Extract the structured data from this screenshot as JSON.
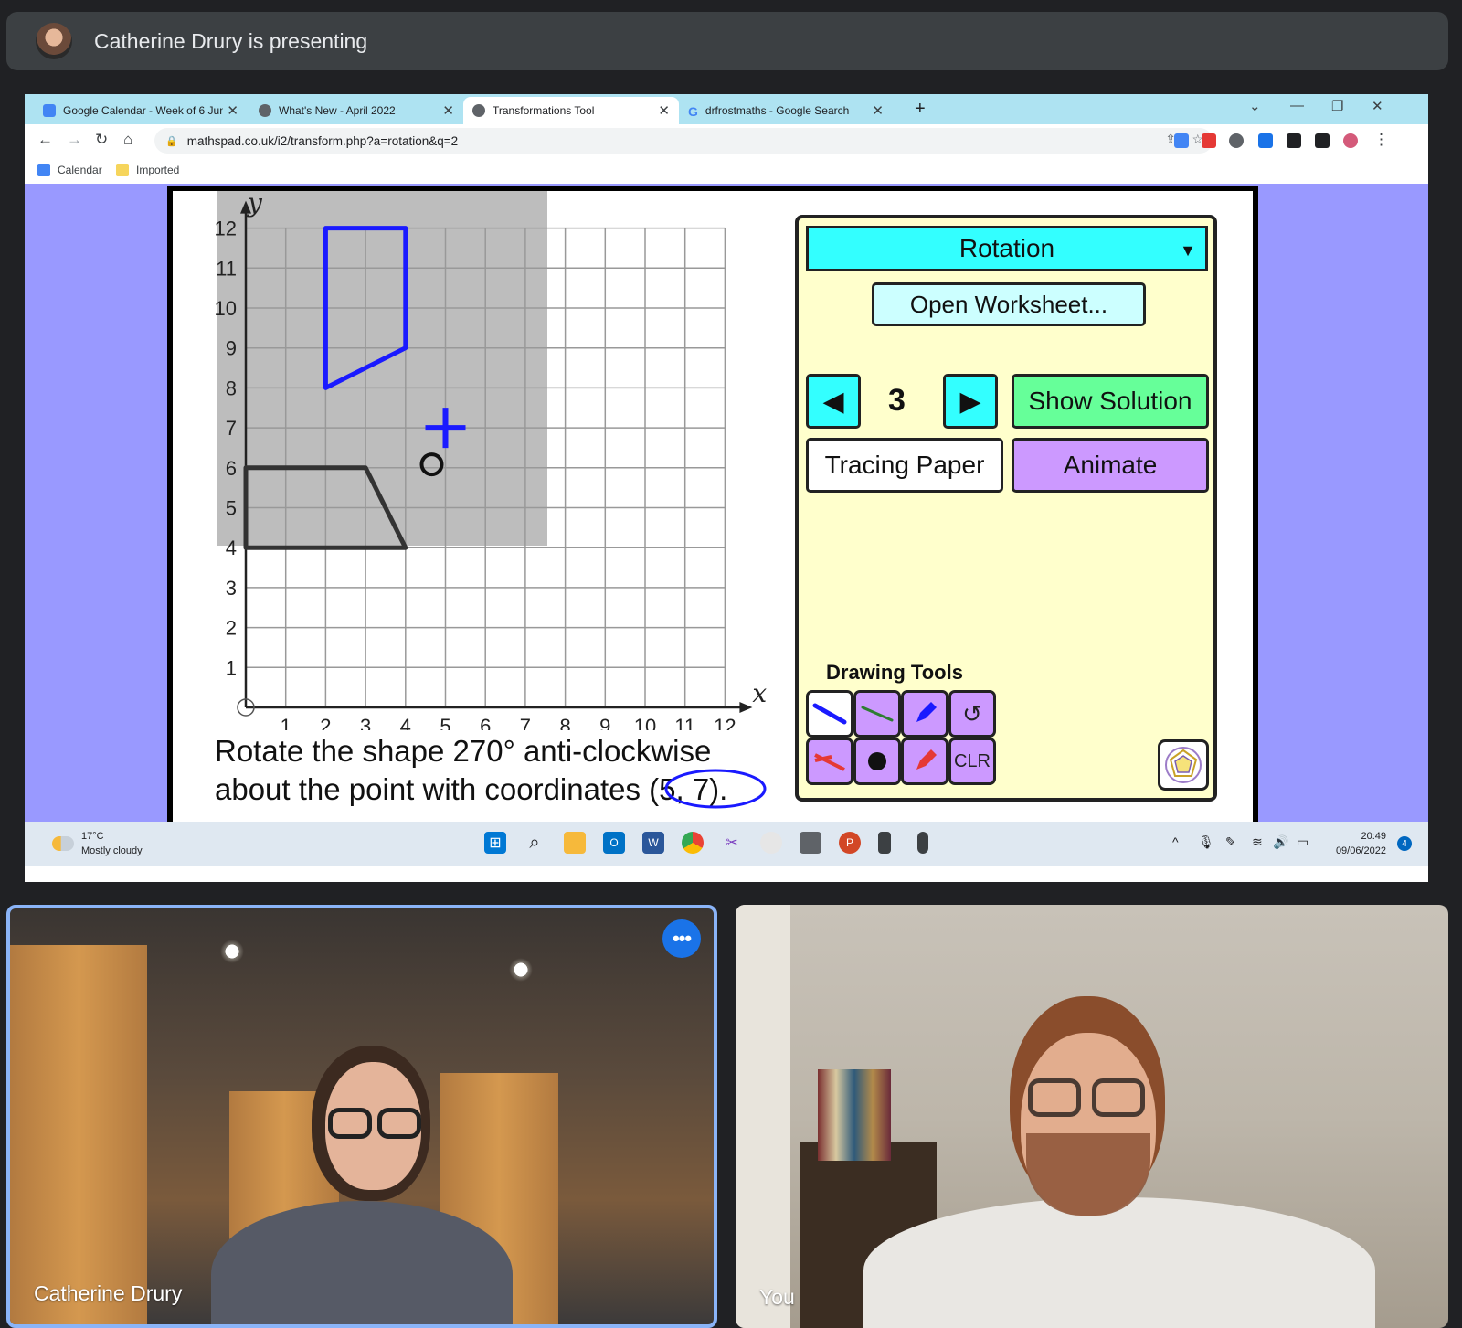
{
  "meet": {
    "presenting_text": "Catherine Drury is presenting",
    "tiles": [
      {
        "name": "Catherine Drury"
      },
      {
        "name": "You"
      }
    ],
    "more_options_icon": "more-horizontal-icon"
  },
  "browser": {
    "tabs": [
      {
        "title": "Google Calendar - Week of 6 Jun",
        "icon": "calendar-icon"
      },
      {
        "title": "What's New - April 2022",
        "icon": "whats-new-icon"
      },
      {
        "title": "Transformations Tool",
        "icon": "transform-icon"
      },
      {
        "title": "drfrostmaths - Google Search",
        "icon": "google-icon"
      }
    ],
    "url": "mathspad.co.uk/i2/transform.php?a=rotation&q=2",
    "bookmarks": [
      {
        "label": "Calendar"
      },
      {
        "label": "Imported"
      }
    ]
  },
  "tool": {
    "transformation": "Rotation",
    "open_worksheet": "Open Worksheet...",
    "question_number": "3",
    "show_solution": "Show Solution",
    "tracing_paper": "Tracing Paper",
    "animate": "Animate",
    "drawing_tools_label": "Drawing Tools",
    "clear_label": "CLR",
    "question_line1": "Rotate the shape 270° anti-clockwise",
    "question_line2": "about the point with coordinates (5, 7).",
    "graph": {
      "x_label": "x",
      "y_label": "y",
      "x_ticks": [
        "1",
        "2",
        "3",
        "4",
        "5",
        "6",
        "7",
        "8",
        "9",
        "10",
        "11",
        "12"
      ],
      "y_ticks": [
        "1",
        "2",
        "3",
        "4",
        "5",
        "6",
        "7",
        "8",
        "9",
        "10",
        "11",
        "12"
      ],
      "x_range": [
        0,
        12
      ],
      "y_range": [
        0,
        12
      ],
      "center_of_rotation": {
        "x": 5,
        "y": 7
      },
      "original_shape": [
        [
          0,
          4
        ],
        [
          4,
          4
        ],
        [
          3,
          6
        ],
        [
          0,
          6
        ]
      ],
      "blue_shape": [
        [
          2,
          8
        ],
        [
          4,
          9
        ],
        [
          4,
          12
        ],
        [
          2,
          12
        ]
      ],
      "colors": {
        "original": "#333333",
        "blue": "#1a1aff",
        "shade": "#bdbdbd"
      }
    }
  },
  "taskbar": {
    "temperature": "17°C",
    "weather": "Mostly cloudy",
    "time": "20:49",
    "date": "09/06/2022",
    "notifications": "4"
  }
}
